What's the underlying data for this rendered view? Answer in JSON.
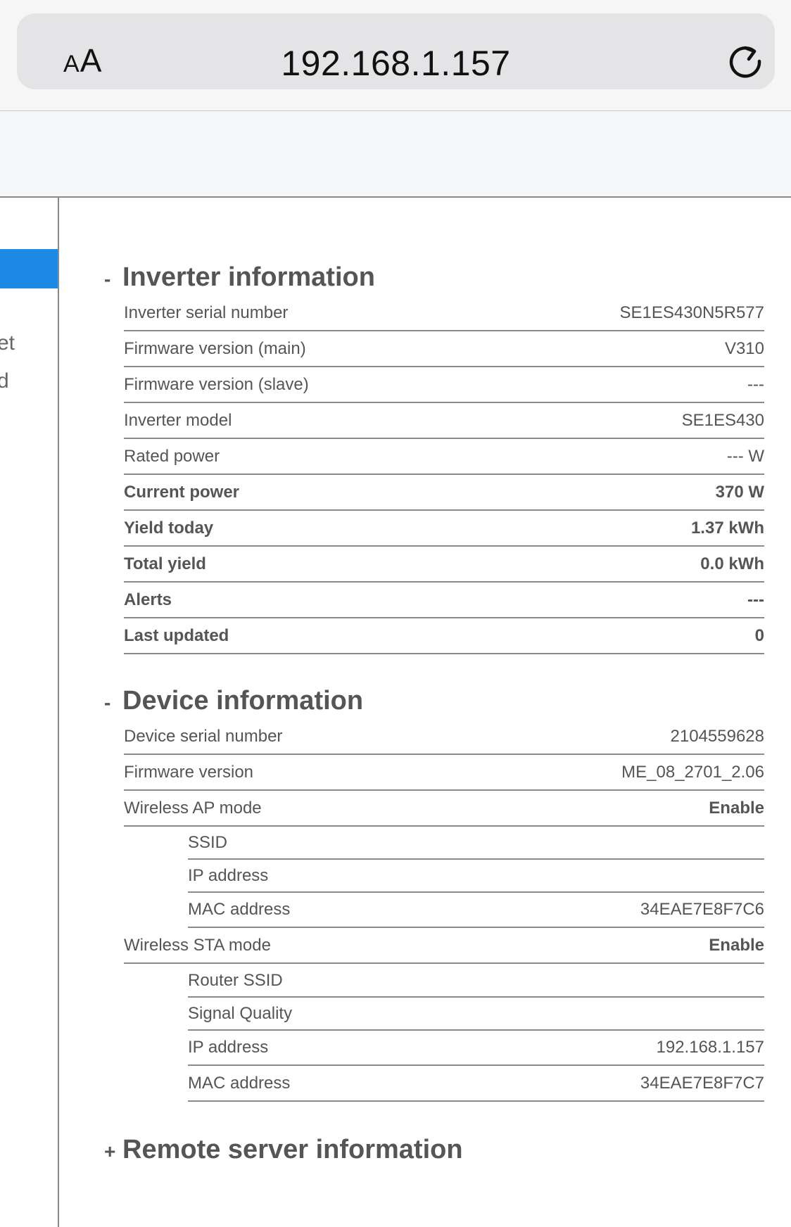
{
  "browser": {
    "text_size_small": "A",
    "text_size_big": "A",
    "url": "192.168.1.157"
  },
  "sidebar": {
    "items": [
      {
        "label": "et"
      },
      {
        "label": "d"
      }
    ],
    "accent_color": "#1e88e5"
  },
  "inverter": {
    "toggle": "-",
    "title": "Inverter information",
    "rows": [
      {
        "label": "Inverter serial number",
        "value": "SE1ES430N5R577"
      },
      {
        "label": "Firmware version (main)",
        "value": "V310"
      },
      {
        "label": "Firmware version (slave)",
        "value": "---"
      },
      {
        "label": "Inverter model",
        "value": "SE1ES430"
      },
      {
        "label": "Rated power",
        "value": "--- W"
      },
      {
        "label": "Current power",
        "value": "370 W"
      },
      {
        "label": "Yield today",
        "value": "1.37 kWh"
      },
      {
        "label": "Total yield",
        "value": "0.0 kWh"
      },
      {
        "label": "Alerts",
        "value": "---"
      },
      {
        "label": "Last updated",
        "value": "0"
      }
    ]
  },
  "device": {
    "toggle": "-",
    "title": "Device information",
    "rows": [
      {
        "label": "Device serial number",
        "value": "2104559628"
      },
      {
        "label": "Firmware version",
        "value": "ME_08_2701_2.06"
      },
      {
        "label": "Wireless AP mode",
        "value": "Enable"
      },
      {
        "label": "SSID",
        "value": ""
      },
      {
        "label": "IP address",
        "value": ""
      },
      {
        "label": "MAC address",
        "value": "34EAE7E8F7C6"
      },
      {
        "label": "Wireless STA mode",
        "value": "Enable"
      },
      {
        "label": "Router SSID",
        "value": ""
      },
      {
        "label": "Signal Quality",
        "value": ""
      },
      {
        "label": "IP address",
        "value": "192.168.1.157"
      },
      {
        "label": "MAC address",
        "value": "34EAE7E8F7C7"
      }
    ]
  },
  "remote": {
    "toggle": "+",
    "title": "Remote server information"
  }
}
